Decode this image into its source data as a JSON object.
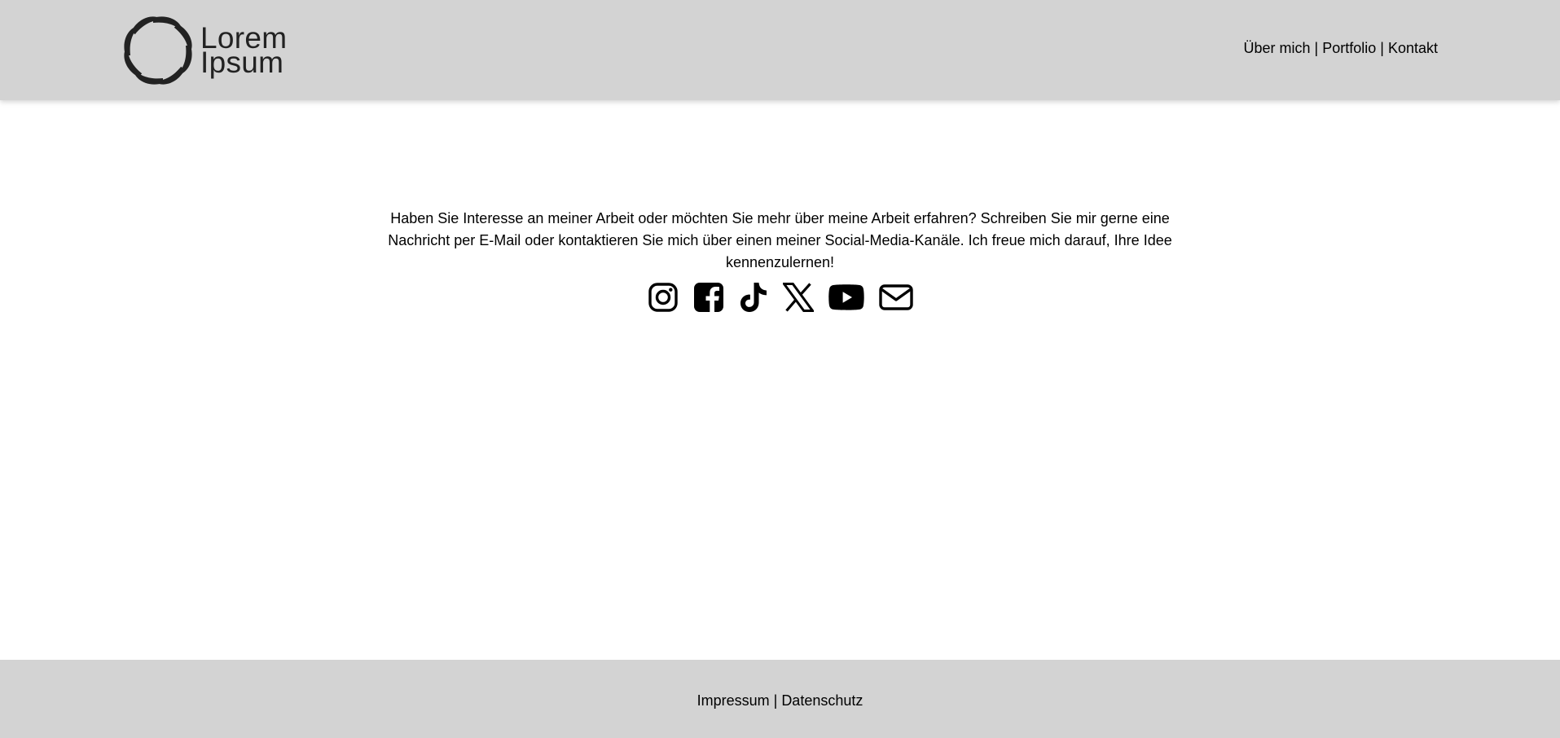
{
  "header": {
    "logo": {
      "line1": "Lorem",
      "line2": "Ipsum",
      "icon": "flower-ring-logo-icon"
    },
    "nav": [
      {
        "label": "Über mich"
      },
      {
        "label": "Portfolio"
      },
      {
        "label": "Kontakt"
      }
    ],
    "separator": " | "
  },
  "main": {
    "intro_text": "Haben Sie Interesse an meiner Arbeit oder möchten Sie mehr über meine Arbeit erfahren? Schreiben Sie mir gerne eine Nachricht per E-Mail oder kontaktieren Sie mich über einen meiner Social-Media-Kanäle. Ich freue mich darauf, Ihre Idee kennenzulernen!",
    "social_icons": [
      "instagram-icon",
      "facebook-icon",
      "tiktok-icon",
      "x-icon",
      "youtube-icon",
      "email-icon"
    ]
  },
  "footer": {
    "links": [
      {
        "label": "Impressum"
      },
      {
        "label": "Datenschutz"
      }
    ],
    "separator": " | "
  },
  "colors": {
    "header_bg": "#d3d3d3",
    "footer_bg": "#d3d3d3",
    "page_bg": "#ffffff",
    "text": "#000000",
    "logo": "#222222"
  }
}
